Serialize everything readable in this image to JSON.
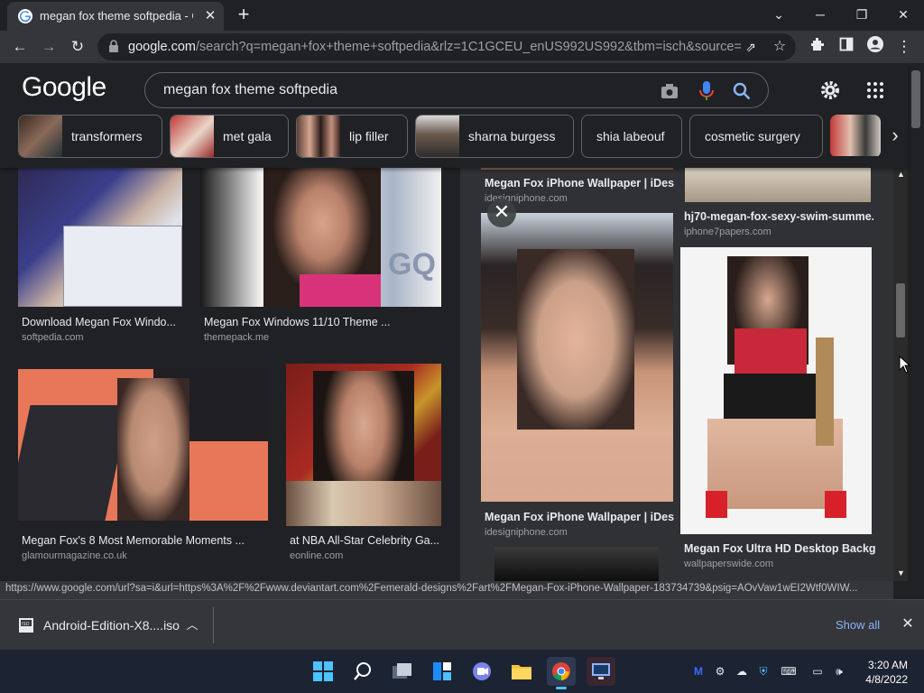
{
  "browser": {
    "tab_title": "megan fox theme softpedia - Go",
    "url_host": "google.com",
    "url_rest": "/search?q=megan+fox+theme+softpedia&rlz=1C1GCEU_enUS992US992&tbm=isch&source=l...",
    "new_tab_glyph": "+",
    "tab_close_glyph": "✕"
  },
  "google": {
    "logo": "Google",
    "query": "megan fox theme softpedia",
    "chips": [
      {
        "label": "transformers"
      },
      {
        "label": "met gala"
      },
      {
        "label": "lip filler"
      },
      {
        "label": "sharna burgess"
      },
      {
        "label": "shia labeouf"
      },
      {
        "label": "cosmetic surgery"
      }
    ]
  },
  "results": [
    {
      "title": "Download Megan Fox Windo...",
      "source": "softpedia.com"
    },
    {
      "title": "Megan Fox Windows 11/10 Theme ...",
      "source": "themepack.me"
    },
    {
      "title": "Megan Fox's 8 Most Memorable Moments ...",
      "source": "glamourmagazine.co.uk"
    },
    {
      "title": "at NBA All-Star Celebrity Ga...",
      "source": "eonline.com"
    }
  ],
  "panel": [
    {
      "title": "Megan Fox iPhone Wallpaper | iDesi...",
      "source": "idesigniphone.com"
    },
    {
      "title": "hj70-megan-fox-sexy-swim-summe...",
      "source": "iphone7papers.com"
    },
    {
      "title": "Megan Fox iPhone Wallpaper | iDesi...",
      "source": "idesigniphone.com"
    },
    {
      "title": "Megan Fox Ultra HD Desktop Backg...",
      "source": "wallpaperswide.com"
    }
  ],
  "status_url": "https://www.google.com/url?sa=i&url=https%3A%2F%2Fwww.deviantart.com%2Femerald-designs%2Fart%2FMegan-Fox-iPhone-Wallpaper-183734739&psig=AOvVaw1wEI2Wtf0WIW...",
  "downloads": {
    "file_name": "Android-Edition-X8....iso",
    "show_all": "Show all"
  },
  "taskbar": {
    "time": "3:20 AM",
    "date": "4/8/2022"
  },
  "colors": {
    "accent_blue": "#8ab4f8",
    "chip_border": "#5f6368",
    "panel_bg": "#303134"
  }
}
